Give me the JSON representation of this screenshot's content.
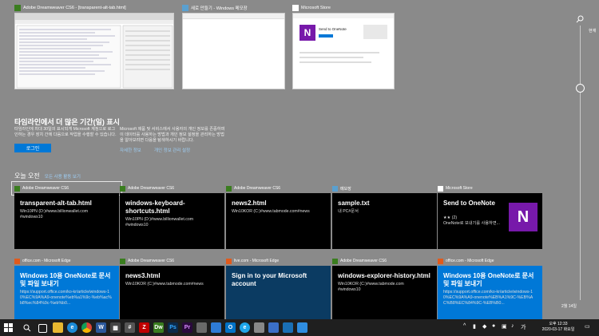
{
  "open_windows": [
    {
      "title": "Adobe Dreamweaver CS6 - [transparent-alt-tab.html]",
      "icon": "dreamweaver-icon"
    },
    {
      "title": "새로 만들기 - Windows 메모장",
      "icon": "notepad-icon"
    },
    {
      "title": "Microsoft Store",
      "icon": "store-icon"
    }
  ],
  "store_preview": {
    "product": "Send to OneNote"
  },
  "promo": {
    "title": "타임라인에서 더 많은 기간(일) 표시",
    "text_left": "타임라인에 최대 30일의 표시되게 Microsoft 계정으로 로그인하는 경우 장치 간에 다음으로 작업을 수행할 수 있습니다.",
    "login_button": "로그인",
    "text_right": "Microsoft 제품 및 서비스에서 사용자의 개인 정보를 존중하며 이 데이터를 사용하는 방법과 개인 정보 설정을 관리하는 방법을 알아보려면 다음을 탐색하시기 바랍니다.",
    "link1": "자세한 정보",
    "link2": "개인 정보 관리 설정"
  },
  "section": {
    "title": "오늘 오전",
    "link": "모든 사용 활동 보기"
  },
  "cards": [
    {
      "source": "Adobe Dreamweaver CS6",
      "title": "transparent-alt-tab.html",
      "sub": "Win10PN (D:)#www.billionwallet.com\n#windows10",
      "bg": "#000000",
      "icon_color": "#3a7d1f"
    },
    {
      "source": "Adobe Dreamweaver CS6",
      "title": "windows-keyboard-shortcuts.html",
      "sub": "Win10PN (D:)#www.billionwallet.com\n#windows10",
      "bg": "#000000",
      "icon_color": "#3a7d1f"
    },
    {
      "source": "Adobe Dreamweaver CS6",
      "title": "news2.html",
      "sub": "Win10KOR (C:)#www.tabmode.com#news",
      "bg": "#000000",
      "icon_color": "#3a7d1f"
    },
    {
      "source": "메모장",
      "title": "sample.txt",
      "sub": "내 PC#문서",
      "bg": "#000000",
      "icon_color": "#5aa0d0"
    },
    {
      "source": "Microsoft Store",
      "title": "Send to OneNote",
      "sub": "★★ (2)\nOneNote로 보내기를 사용하면...",
      "bg": "#000000",
      "icon_color": "#ffffff"
    },
    {
      "source": "office.com - Microsoft Edge",
      "title": "Windows 10용 OneNote로 문서 및 파일 보내기",
      "sub": "https://support.office.com/ko-kr/article/windows-10%EC%9A%A9-onenote%eb%a1%9c-%eb%ac%b8%ec%84%9c-%eb%b0...",
      "bg": "#0078d7",
      "icon_color": "#e05a1c"
    },
    {
      "source": "Adobe Dreamweaver CS6",
      "title": "news3.html",
      "sub": "Win10KOR (C:)#www.tabmode.com#news",
      "bg": "#000000",
      "icon_color": "#3a7d1f"
    },
    {
      "source": "live.com - Microsoft Edge",
      "title": "Sign in to your Microsoft account",
      "sub": "",
      "bg": "#0b3b62",
      "icon_color": "#e05a1c"
    },
    {
      "source": "Adobe Dreamweaver CS6",
      "title": "windows-explorer-history.html",
      "sub": "Win10KOR (C:)#www.tabmode.com\n#windows10",
      "bg": "#000000",
      "icon_color": "#3a7d1f"
    },
    {
      "source": "office.com - Microsoft Edge",
      "title": "Windows 10용 OneNote로 문서 및 파일 보내기",
      "sub": "https://support.office.com/ko-kr/article/windows-10%EC%9A%A9-onenote%EB%A1%9C-%EB%AC%B8%EC%84%9C-%EB%B0...",
      "bg": "#0078d7",
      "icon_color": "#e05a1c"
    }
  ],
  "timeline": {
    "top_label": "현재",
    "bottom_label": "2월 14일"
  },
  "tray": {
    "time": "오후 12:33",
    "date": "2020-03-17 화요일"
  }
}
